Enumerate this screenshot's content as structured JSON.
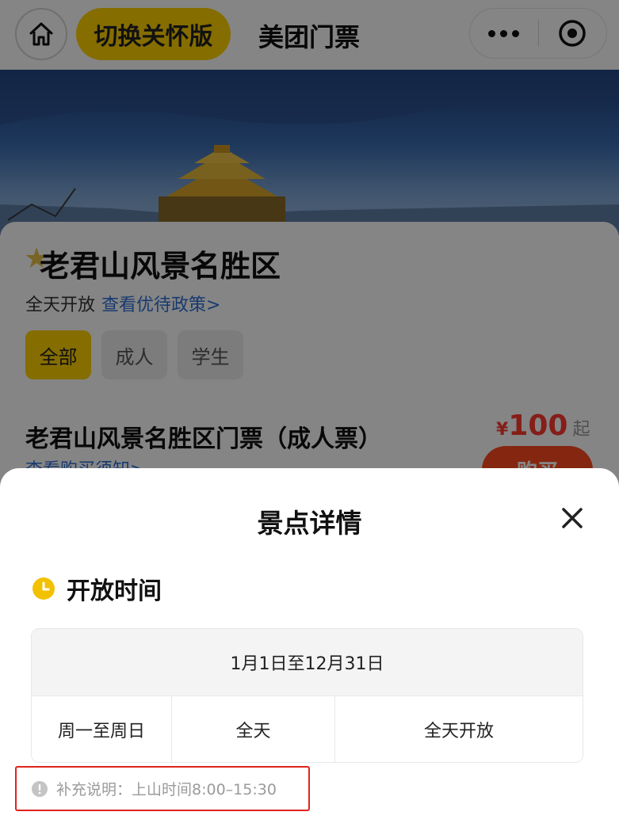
{
  "top_bar": {
    "care_mode_label": "切换关怀版",
    "app_title": "美团门票",
    "icons": [
      "home-icon",
      "more-icon",
      "target-icon"
    ]
  },
  "attraction": {
    "name": "老君山风景名胜区",
    "open_status": "全天开放",
    "policy_link": "查看优待政策>",
    "tags": [
      "全部",
      "成人",
      "学生"
    ],
    "active_tag": "全部"
  },
  "ticket": {
    "name": "老君山风景名胜区门票（成人票）",
    "link": "查看购买须知>",
    "price_currency": "¥",
    "price": "100",
    "price_suffix": "起",
    "buy_label": "购买"
  },
  "sheet": {
    "title": "景点详情",
    "section_title": "开放时间",
    "hours": {
      "date_range": "1月1日至12月31日",
      "days": "周一至周日",
      "period": "全天",
      "status": "全天开放"
    },
    "note": "补充说明：上山时间8:00–15:30"
  },
  "colors": {
    "brand_yellow": "#ffd100",
    "price_red": "#ff3b30",
    "link_blue": "#2f6fd6",
    "highlight_red": "#e0241c"
  }
}
